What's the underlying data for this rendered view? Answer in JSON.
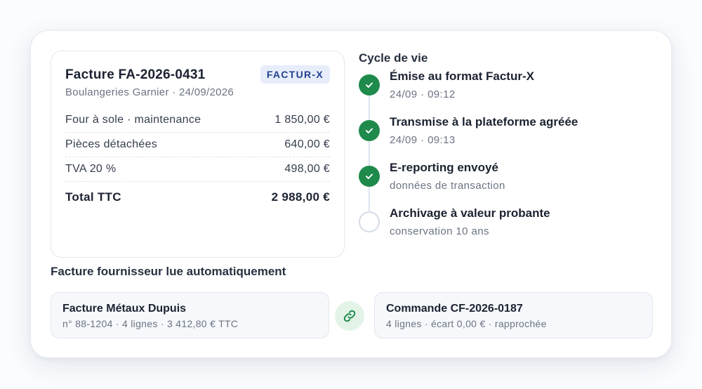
{
  "invoice": {
    "title": "Facture FA-2026-0431",
    "subtitle": "Boulangeries Garnier · 24/09/2026",
    "badge": "FACTUR-X",
    "lines": [
      {
        "label": "Four à sole · maintenance",
        "amount": "1 850,00 €"
      },
      {
        "label": "Pièces détachées",
        "amount": "640,00 €"
      },
      {
        "label": "TVA 20 %",
        "amount": "498,00 €"
      }
    ],
    "total": {
      "label": "Total TTC",
      "amount": "2 988,00 €"
    }
  },
  "lifecycle": {
    "title": "Cycle de vie",
    "steps": [
      {
        "title": "Émise au format Factur-X",
        "sub": "24/09 · 09:12",
        "status": "done"
      },
      {
        "title": "Transmise à la plateforme agréée",
        "sub": "24/09 · 09:13",
        "status": "done"
      },
      {
        "title": "E-reporting envoyé",
        "sub": "données de transaction",
        "status": "done"
      },
      {
        "title": "Archivage à valeur probante",
        "sub": "conservation 10 ans",
        "status": "pending"
      }
    ]
  },
  "supplier": {
    "title": "Facture fournisseur lue automatiquement",
    "invoice": {
      "title": "Facture Métaux Dupuis",
      "sub": "n° 88-1204 · 4 lignes · 3 412,80 € TTC"
    },
    "order": {
      "title": "Commande CF-2026-0187",
      "sub": "4 lignes · écart 0,00 € · rapprochée"
    },
    "link_icon": "link-icon"
  },
  "colors": {
    "accent_green": "#1e8a4b",
    "badge_bg": "#e7edfb",
    "badge_text": "#22418f"
  }
}
